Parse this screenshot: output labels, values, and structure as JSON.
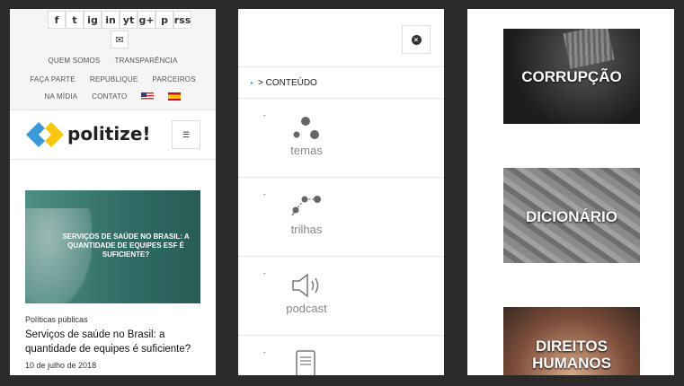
{
  "panel1": {
    "social_icons": [
      "f",
      "t",
      "ig",
      "in",
      "yt",
      "g+",
      "p",
      "rss"
    ],
    "social_icon_names": [
      "facebook-icon",
      "twitter-icon",
      "instagram-icon",
      "linkedin-icon",
      "youtube-icon",
      "googleplus-icon",
      "pinterest-icon",
      "rss-icon"
    ],
    "mail_icon": "✉",
    "menu": {
      "row1": [
        "QUEM SOMOS",
        "TRANSPARÊNCIA"
      ],
      "row2": [
        "FAÇA PARTE",
        "REPUBLIQUE",
        "PARCEIROS"
      ],
      "row3": [
        "NA MÍDIA",
        "CONTATO"
      ]
    },
    "logo_text": "politize!",
    "menu_icon": "☰",
    "article": {
      "image_text": "SERVIÇOS DE SAÚDE NO BRASIL: A QUANTIDADE DE EQUIPES ESF É SUFICIENTE?",
      "category": "Políticas públicas",
      "title": "Serviços de saúde no Brasil: a quantidade de equipes é suficiente?",
      "date": "10 de julho de 2018"
    }
  },
  "panel2": {
    "section_label": "> CONTEÚDO",
    "items": [
      {
        "bullet": "-",
        "label": "temas",
        "icon": "temas-icon"
      },
      {
        "bullet": "-",
        "label": "trilhas",
        "icon": "trilhas-icon"
      },
      {
        "bullet": "-",
        "label": "podcast",
        "icon": "podcast-icon"
      },
      {
        "bullet": "-",
        "label": "",
        "icon": "ebook-icon"
      }
    ]
  },
  "panel3": {
    "tiles": [
      {
        "label": "CORRUPÇÃO"
      },
      {
        "label": "DICIONÁRIO"
      },
      {
        "label": "DIREITOS HUMANOS"
      }
    ]
  },
  "colors": {
    "logo_blue": "#3a9ad9",
    "logo_yellow": "#f5c400",
    "thumb_green": "#2f6b64",
    "text_gray": "#888888"
  }
}
